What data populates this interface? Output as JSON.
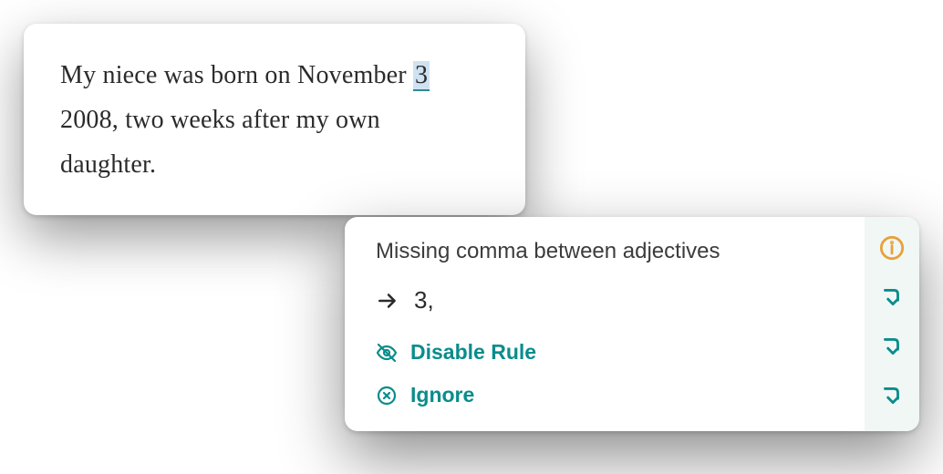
{
  "editor": {
    "text_before": "My niece was born on November ",
    "highlighted": "3",
    "text_after": " 2008, two weeks after my own daughter."
  },
  "popup": {
    "rule_title": "Missing comma between adjectives",
    "suggestion": "3,",
    "actions": {
      "disable": "Disable Rule",
      "ignore": "Ignore"
    }
  },
  "colors": {
    "teal": "#0a8c8c",
    "orange": "#e8a13a"
  }
}
